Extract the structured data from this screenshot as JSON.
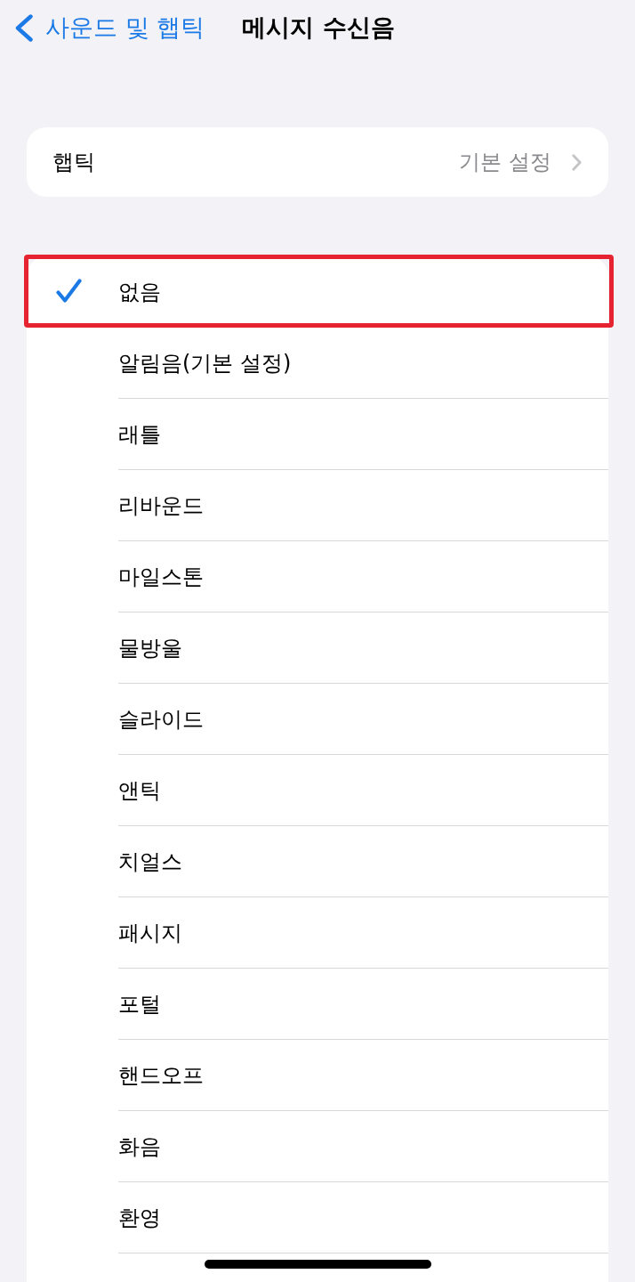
{
  "nav_bar": {
    "back_label": "사운드 및 햅틱",
    "title": "메시지 수신음"
  },
  "haptics": {
    "label": "햅틱",
    "value": "기본 설정"
  },
  "tones": [
    {
      "name": "없음",
      "selected": true,
      "highlighted": true
    },
    {
      "name": "알림음(기본 설정)",
      "selected": false,
      "highlighted": false
    },
    {
      "name": "래틀",
      "selected": false,
      "highlighted": false
    },
    {
      "name": "리바운드",
      "selected": false,
      "highlighted": false
    },
    {
      "name": "마일스톤",
      "selected": false,
      "highlighted": false
    },
    {
      "name": "물방울",
      "selected": false,
      "highlighted": false
    },
    {
      "name": "슬라이드",
      "selected": false,
      "highlighted": false
    },
    {
      "name": "앤틱",
      "selected": false,
      "highlighted": false
    },
    {
      "name": "치얼스",
      "selected": false,
      "highlighted": false
    },
    {
      "name": "패시지",
      "selected": false,
      "highlighted": false
    },
    {
      "name": "포털",
      "selected": false,
      "highlighted": false
    },
    {
      "name": "핸드오프",
      "selected": false,
      "highlighted": false
    },
    {
      "name": "화음",
      "selected": false,
      "highlighted": false
    },
    {
      "name": "환영",
      "selected": false,
      "highlighted": false
    }
  ]
}
